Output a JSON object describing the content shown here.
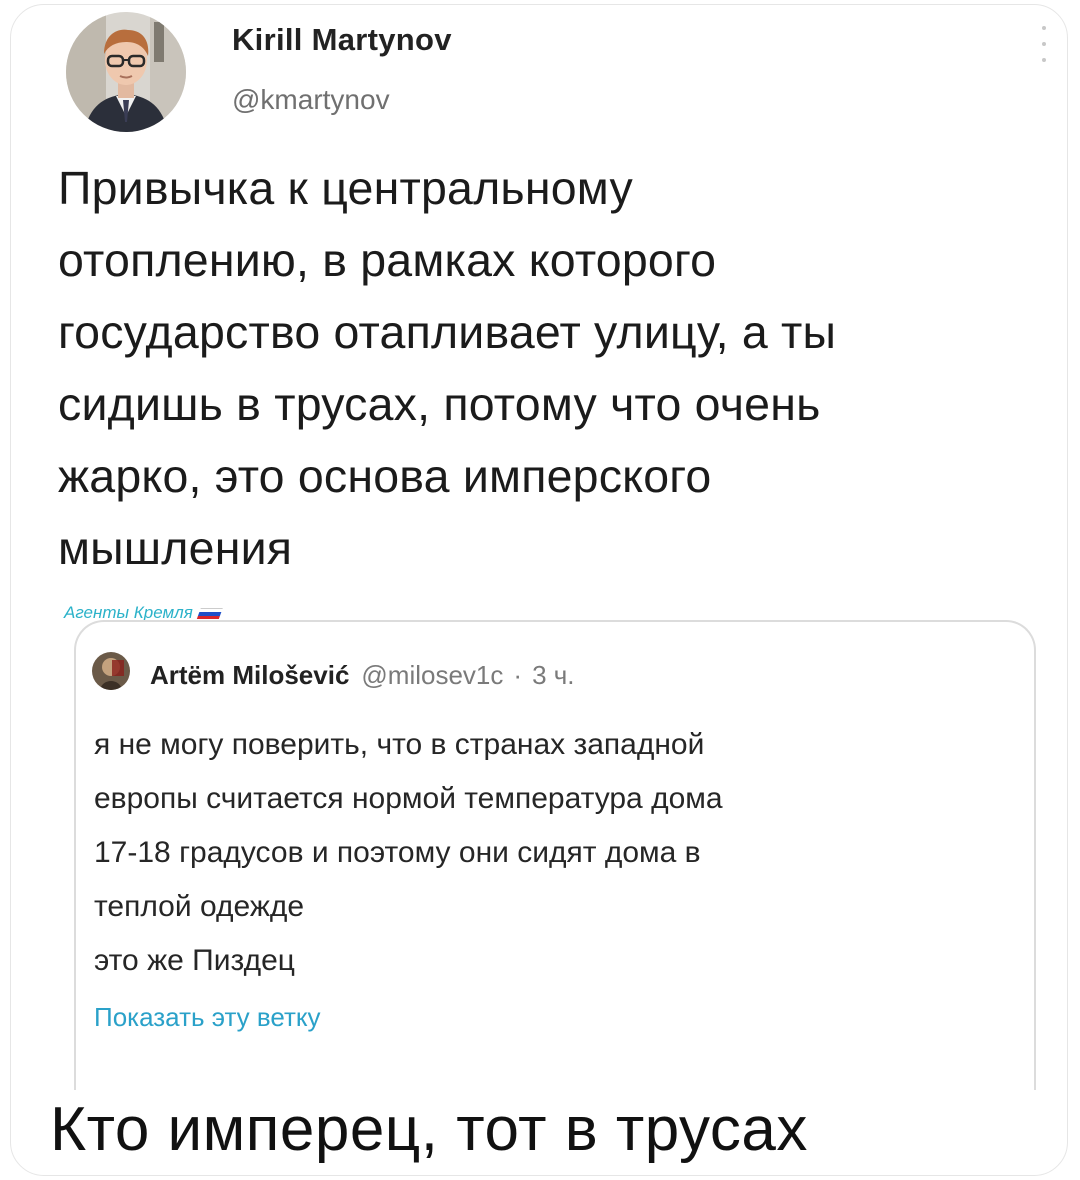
{
  "tweet": {
    "author_name": "Kirill Martynov",
    "author_handle": "@kmartynov",
    "text_lines": [
      "Привычка к центральному",
      "отоплению, в рамках которого",
      "государство отапливает улицу, а ты",
      "сидишь в трусах, потому что очень",
      "жарко, это основа имперского",
      "мышления"
    ],
    "more_icon": "more-vertical-icon"
  },
  "watermark": {
    "text": "Агенты Кремля",
    "flag_colors": [
      "#ffffff",
      "#1f4fc9",
      "#d9262b"
    ]
  },
  "quoted_tweet": {
    "author_name": "Artëm Milošević",
    "author_handle": "@milosev1c",
    "separator": "·",
    "time": "3 ч.",
    "text_lines": [
      "я не могу поверить, что в странах западной",
      "европы считается нормой температура дома",
      "17-18 градусов и поэтому они сидят дома в",
      "теплой одежде",
      "это же Пиздец"
    ],
    "show_thread_label": "Показать эту ветку"
  },
  "caption": "Кто имперец, тот в трусах",
  "colors": {
    "link": "#2aa1c9",
    "watermark": "#2bb2c9",
    "muted": "#707070"
  }
}
